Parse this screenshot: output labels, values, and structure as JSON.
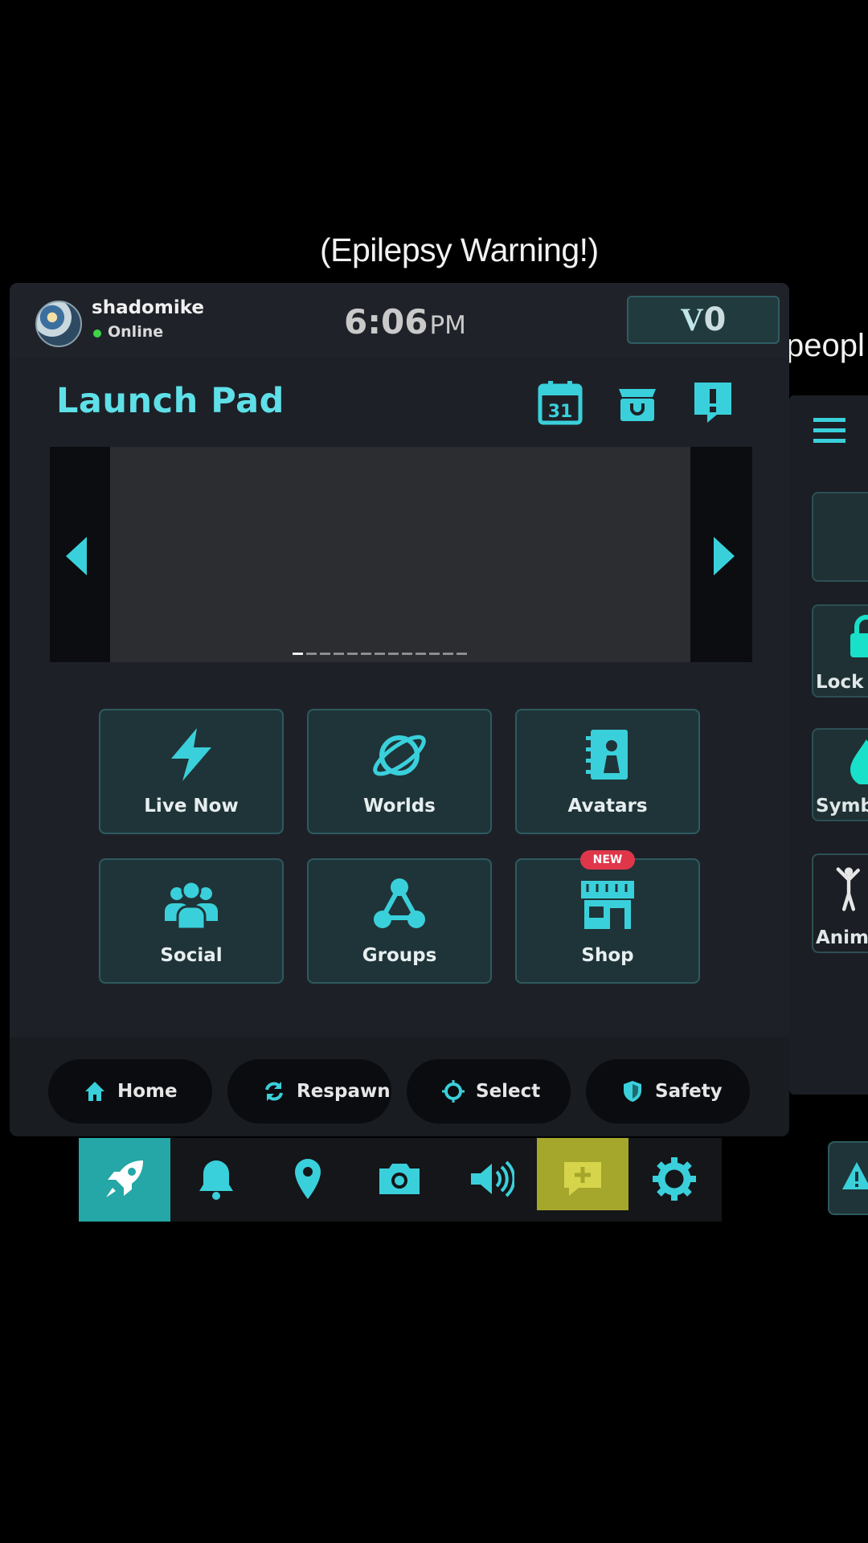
{
  "overlay": {
    "caption": "(Epilepsy Warning!)",
    "right_caption": "peopl"
  },
  "user": {
    "name": "shadomike",
    "status": "Online"
  },
  "clock": {
    "time": "6:06",
    "ampm": "PM"
  },
  "currency": {
    "symbol": "V",
    "amount": "0",
    "display": "V0"
  },
  "launchpad": {
    "title": "Launch Pad",
    "header_icons": [
      "calendar-icon",
      "inventory-icon",
      "alert-icon"
    ],
    "calendar_day": "31",
    "carousel": {
      "slide_count": 13,
      "active_index": 0
    },
    "tiles": [
      {
        "label": "Live Now",
        "icon": "lightning-icon"
      },
      {
        "label": "Worlds",
        "icon": "planet-icon"
      },
      {
        "label": "Avatars",
        "icon": "avatar-book-icon"
      },
      {
        "label": "Social",
        "icon": "people-icon"
      },
      {
        "label": "Groups",
        "icon": "groups-icon"
      },
      {
        "label": "Shop",
        "icon": "shop-icon",
        "badge": "NEW"
      }
    ]
  },
  "bottom_nav": [
    {
      "label": "Home",
      "icon": "home-icon"
    },
    {
      "label": "Respawn",
      "icon": "respawn-icon"
    },
    {
      "label": "Select",
      "icon": "select-icon"
    },
    {
      "label": "Safety",
      "icon": "shield-icon"
    }
  ],
  "quick_menu": {
    "items": [
      "rocket-icon",
      "bell-icon",
      "location-pin-icon",
      "camera-icon",
      "speaker-icon",
      "chat-add-icon",
      "gear-icon"
    ],
    "active": "rocket-icon"
  },
  "side_panel": {
    "items": [
      {
        "label": "",
        "icon": "blank-tile"
      },
      {
        "label": "Lock",
        "icon": "lock-icon"
      },
      {
        "label": "Symb",
        "icon": "symbol-icon"
      },
      {
        "label": "Anima",
        "icon": "dance-icon"
      }
    ]
  },
  "colors": {
    "accent": "#5fe0e8",
    "tile_bg": "#1f3438",
    "badge": "#e0364a",
    "active_tool": "#24a7a6",
    "chat_tool": "#a5a62c"
  }
}
